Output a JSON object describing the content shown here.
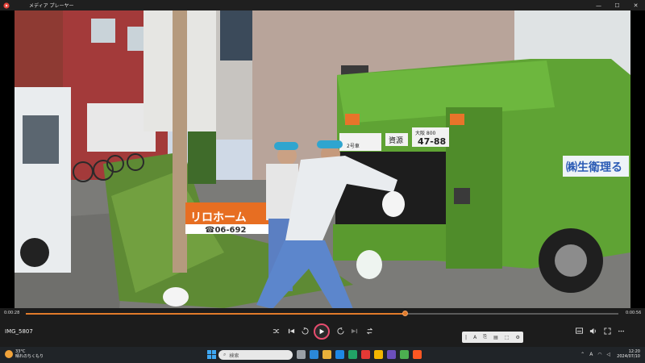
{
  "window": {
    "title": "メディア プレーヤー",
    "controls": [
      "—",
      "☐",
      "✕"
    ]
  },
  "video": {
    "signs": {
      "realestate_name": "リロホーム",
      "realestate_phone": "☎06-692",
      "truck_plate_top": "大阪 800",
      "truck_plate_num": "47-88",
      "truck_company": "㈱生衛理る",
      "truck_tag": "資源",
      "truck_side_small": "2号車"
    }
  },
  "player": {
    "current_time": "0:00:28",
    "total_time": "0:00:56",
    "progress_fraction": 0.64,
    "file_name": "IMG_5807",
    "toolbar_glyphs": [
      "|",
      "A",
      "⎘",
      "▤",
      "⬚",
      "⚙"
    ]
  },
  "taskbar": {
    "weather_temp": "33°C",
    "weather_text": "晴れのちくもり",
    "search_placeholder": "検索",
    "time": "12:20",
    "date": "2024/07/10",
    "tray_letter": "A",
    "app_colors": [
      "#9aa0a6",
      "#2b88d8",
      "#e8b13a",
      "#1e88e5",
      "#21a366",
      "#e53935",
      "#f2b600",
      "#6b4fbb",
      "#4caf50",
      "#ff5722"
    ]
  }
}
